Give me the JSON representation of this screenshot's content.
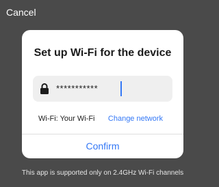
{
  "header": {
    "cancel_label": "Cancel"
  },
  "dialog": {
    "title": "Set up Wi-Fi for the device",
    "password": {
      "icon": "lock-icon",
      "value_masked": "***********"
    },
    "wifi_info": "Wi-Fi: Your Wi-Fi",
    "change_network_label": "Change network",
    "confirm_label": "Confirm"
  },
  "footer": {
    "note": "This app is supported only on 2.4GHz Wi-Fi channels"
  },
  "colors": {
    "background": "#4a4a4a",
    "dialog": "#ffffff",
    "field": "#efefef",
    "accent": "#3478f6",
    "text": "#1b1b1b"
  }
}
